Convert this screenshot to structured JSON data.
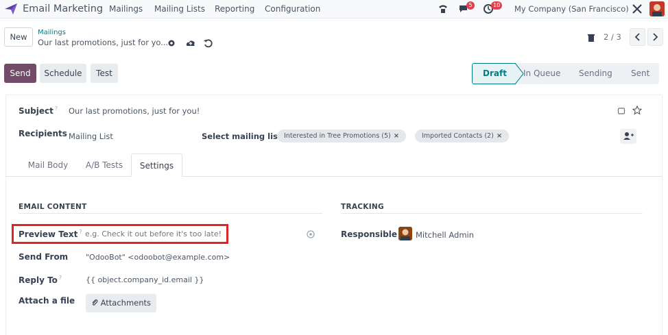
{
  "app": {
    "title": "Email Marketing"
  },
  "menu": [
    "Mailings",
    "Mailing Lists",
    "Reporting",
    "Configuration"
  ],
  "systray": {
    "messages_count": "5",
    "activities_count": "10",
    "company": "My Company (San Francisco)"
  },
  "control": {
    "new_label": "New",
    "breadcrumb_parent": "Mailings",
    "breadcrumb_current": "Our last promotions, just for yo...",
    "pager": "2 / 3"
  },
  "actions": {
    "send": "Send",
    "schedule": "Schedule",
    "test": "Test"
  },
  "status": {
    "steps": [
      "Draft",
      "In Queue",
      "Sending",
      "Sent"
    ],
    "active": "Draft"
  },
  "form": {
    "subject_label": "Subject",
    "subject_value": "Our last promotions, just for you!",
    "recipients_label": "Recipients",
    "recipients_value": "Mailing List",
    "select_lists_label": "Select mailing lists:",
    "tags": [
      "Interested in Tree Promotions (5)",
      "Imported Contacts (2)"
    ],
    "tag_remove": "×"
  },
  "tabs": [
    "Mail Body",
    "A/B Tests",
    "Settings"
  ],
  "active_tab": "Settings",
  "settings": {
    "email_content_title": "EMAIL CONTENT",
    "tracking_title": "TRACKING",
    "preview_text_label": "Preview Text",
    "preview_text_placeholder": "e.g. Check it out before it's too late!",
    "send_from_label": "Send From",
    "send_from_value": "\"OdooBot\" <odoobot@example.com>",
    "reply_to_label": "Reply To",
    "reply_to_value": "{{ object.company_id.email }}",
    "attach_label": "Attach a file",
    "attach_button": "Attachments",
    "responsible_label": "Responsible",
    "responsible_value": "Mitchell Admin"
  },
  "tooltip_mark": "?",
  "colors": {
    "primary": "#714b67",
    "accent": "#017e84",
    "highlight_border": "#e02424"
  },
  "icons": [
    "odoo-logo-icon",
    "phone-icon",
    "chat-icon",
    "clock-icon",
    "tools-icon",
    "gear-icon",
    "cloud-upload-icon",
    "undo-icon",
    "trash-icon",
    "chevron-left-icon",
    "chevron-right-icon",
    "star-icon",
    "lock-icon",
    "user-plus-icon",
    "paperclip-icon",
    "help-circle-icon"
  ]
}
